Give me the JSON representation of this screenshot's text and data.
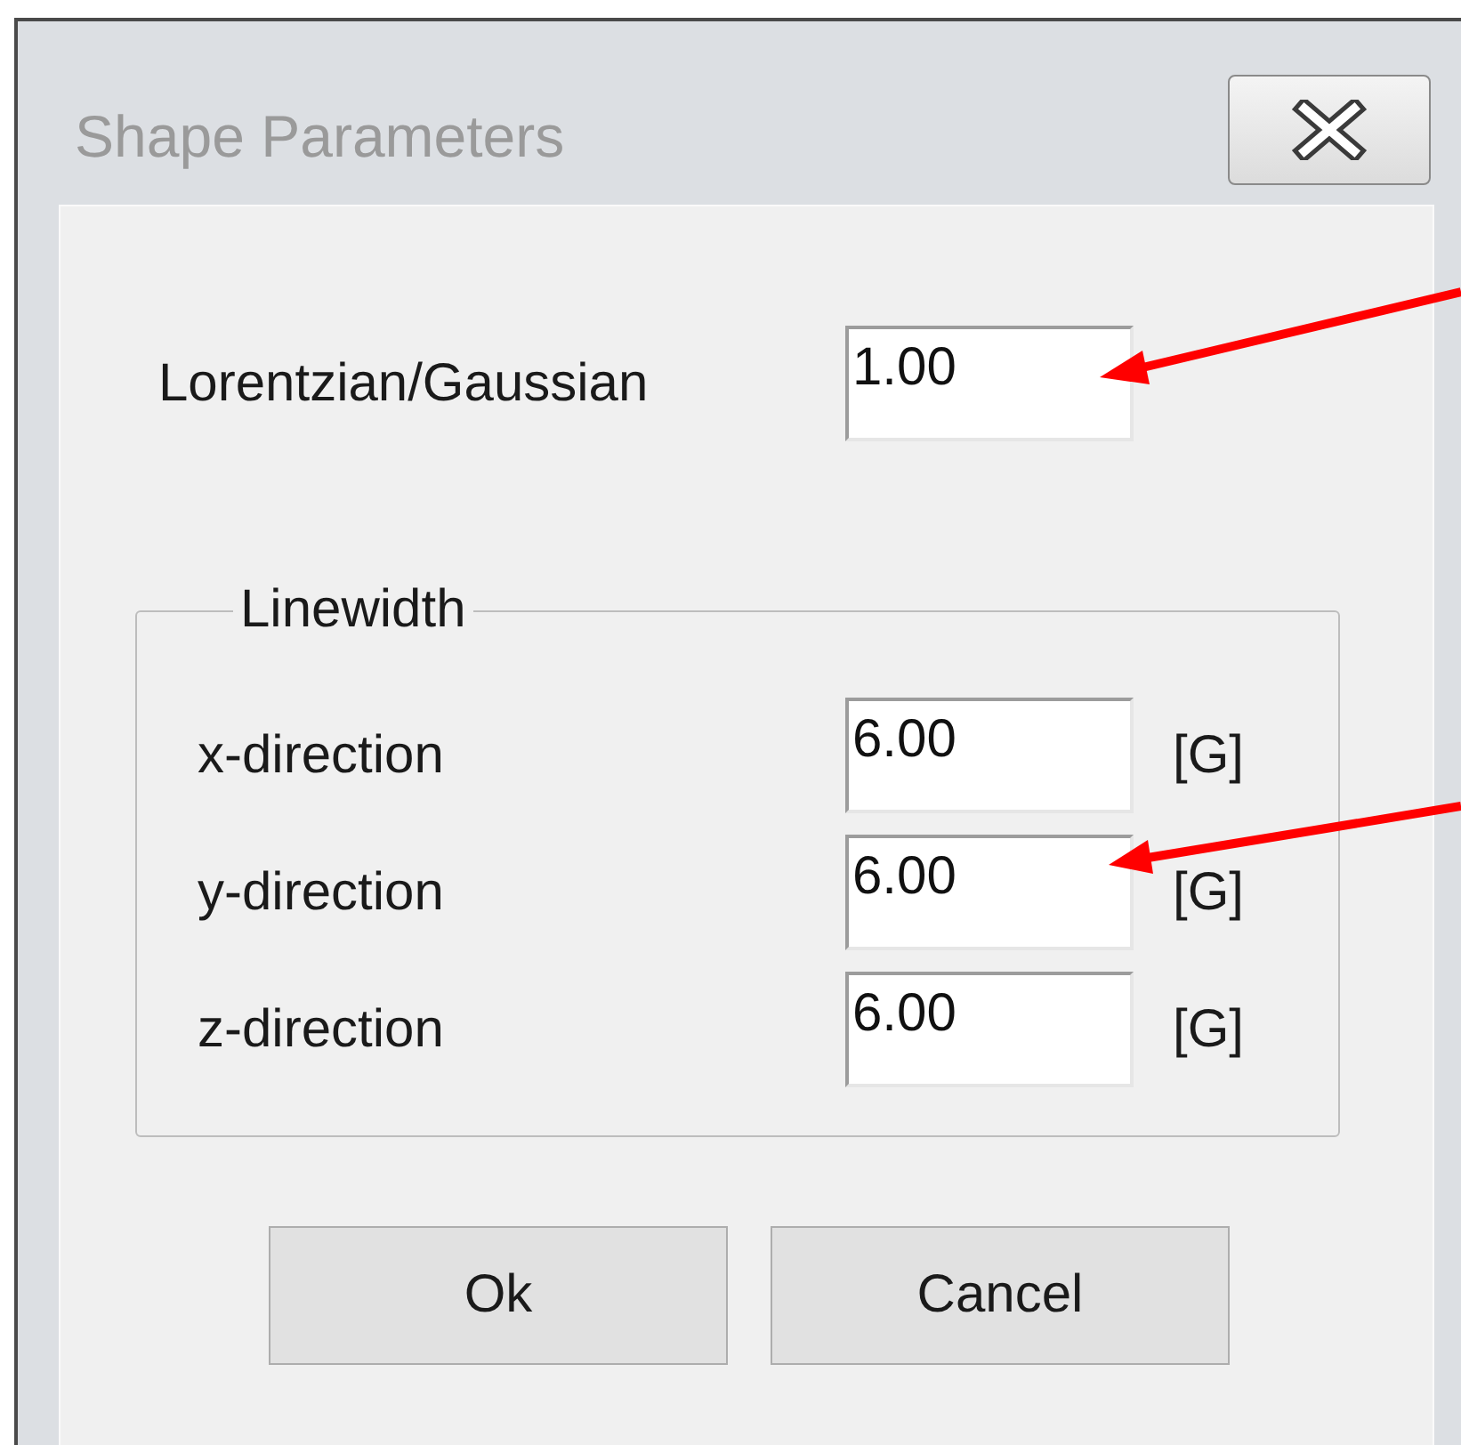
{
  "window": {
    "title": "Shape Parameters"
  },
  "shape_field": {
    "label": "Lorentzian/Gaussian",
    "value": "1.00"
  },
  "linewidth": {
    "title": "Linewidth",
    "rows": [
      {
        "label": "x-direction",
        "value": "6.00",
        "unit": "[G]"
      },
      {
        "label": "y-direction",
        "value": "6.00",
        "unit": "[G]"
      },
      {
        "label": "z-direction",
        "value": "6.00",
        "unit": "[G]"
      }
    ]
  },
  "buttons": [
    "Ok",
    "Cancel"
  ]
}
